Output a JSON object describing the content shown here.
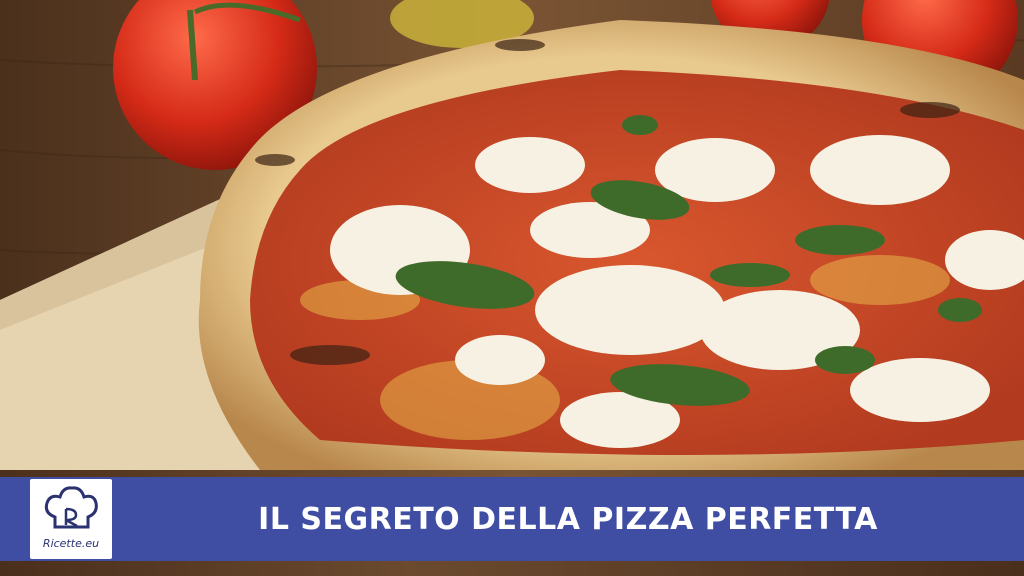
{
  "banner": {
    "headline": "IL SEGRETO DELLA PIZZA PERFETTA",
    "background_color": "#3f4ea3",
    "text_color": "#ffffff"
  },
  "logo": {
    "text": "Ricette.eu",
    "icon": "chef-hat-icon",
    "color": "#2a3270"
  },
  "scene": {
    "subject": "pizza-margherita",
    "colors": {
      "wood": "#6b4a2e",
      "paper": "#e6d3b0",
      "crust": "#e8c98e",
      "sauce": "#c8452a",
      "mozzarella": "#f7f1e3",
      "basil": "#3f6b2a",
      "tomato": "#d42a17"
    }
  }
}
